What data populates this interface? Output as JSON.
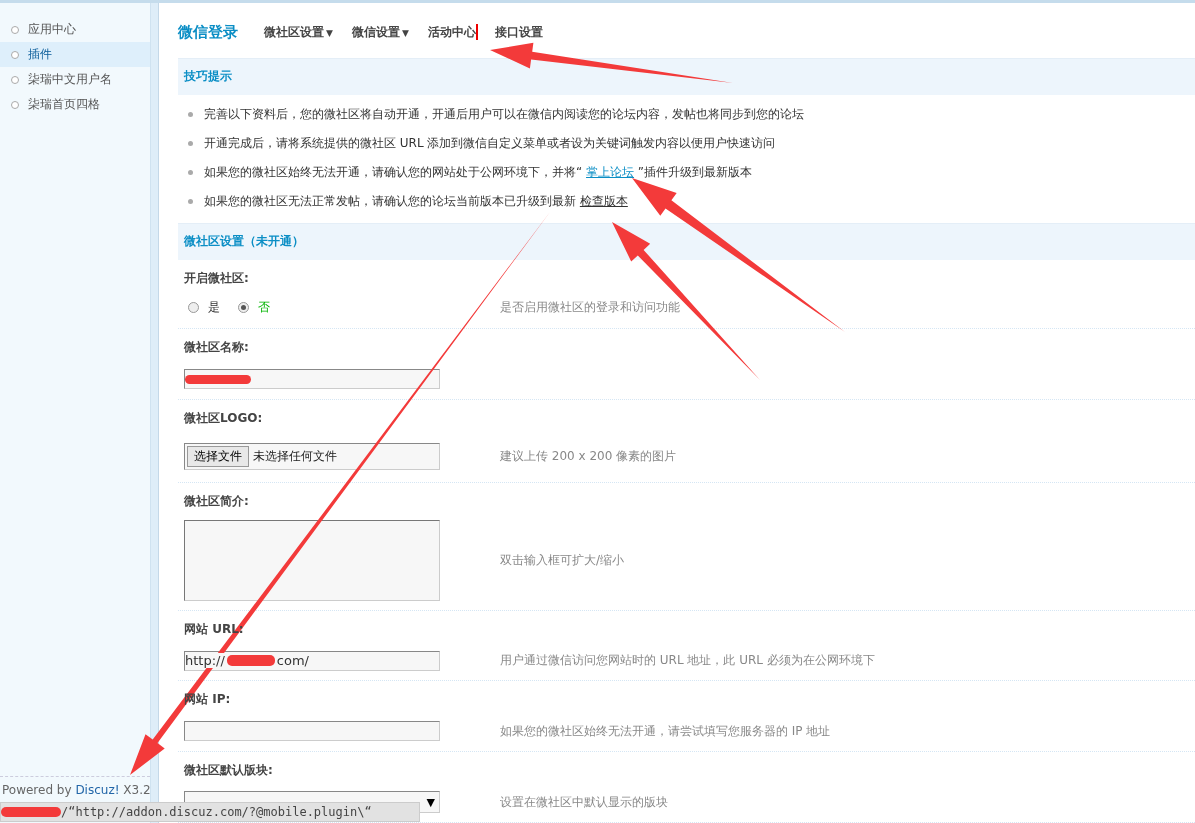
{
  "sidebar": {
    "items": [
      {
        "label": "应用中心",
        "selected": false
      },
      {
        "label": "插件",
        "selected": true
      },
      {
        "label": "柒瑞中文用户名",
        "selected": false
      },
      {
        "label": "柒瑞首页四格",
        "selected": false
      }
    ],
    "footer": {
      "prefix": "Powered by ",
      "link": "Discuz!",
      "suffix": " X3.2"
    }
  },
  "header": {
    "title": "微信登录",
    "tabs": [
      {
        "label": "微社区设置",
        "arrow": "▼"
      },
      {
        "label": "微信设置",
        "arrow": "▼"
      },
      {
        "label": "活动中心",
        "cursor": true
      },
      {
        "label": "接口设置"
      }
    ]
  },
  "tips": {
    "title": "技巧提示",
    "items": [
      {
        "text": "完善以下资料后，您的微社区将自动开通，开通后用户可以在微信内阅读您的论坛内容，发帖也将同步到您的论坛"
      },
      {
        "text": "开通完成后，请将系统提供的微社区 URL 添加到微信自定义菜单或者设为关键词触发内容以便用户快速访问"
      },
      {
        "text": "如果您的微社区始终无法开通，请确认您的网站处于公网环境下，并将“ ",
        "link": "掌上论坛",
        "color": "#0b8ec5",
        "after": " ”插件升级到最新版本"
      },
      {
        "text": "如果您的微社区无法正常发帖，请确认您的论坛当前版本已升级到最新 ",
        "link": "检查版本",
        "color": "#333333"
      }
    ]
  },
  "settings": {
    "title": "微社区设置（未开通）",
    "rows": [
      {
        "kind": "radio",
        "label": "开启微社区:",
        "options": [
          {
            "label": "是",
            "selected": false
          },
          {
            "label": "否",
            "selected": true
          }
        ],
        "help": "是否启用微社区的登录和访问功能"
      },
      {
        "kind": "text",
        "label": "微社区名称:",
        "redacted": true
      },
      {
        "kind": "file",
        "label": "微社区LOGO:",
        "button": "选择文件",
        "status": "未选择任何文件",
        "help": "建议上传 200 x 200 像素的图片"
      },
      {
        "kind": "textarea",
        "label": "微社区简介:",
        "help": "双击输入框可扩大/缩小"
      },
      {
        "kind": "text",
        "label": "网站 URL:",
        "value": "http://",
        "value_end": "com/",
        "redacted": true,
        "help": "用户通过微信访问您网站时的 URL 地址，此 URL 必须为在公网环境下"
      },
      {
        "kind": "text",
        "label": "网站 IP:",
        "help": "如果您的微社区始终无法开通，请尝试填写您服务器的 IP 地址"
      },
      {
        "kind": "select",
        "label": "微社区默认版块:",
        "arrow": "▼",
        "help": "设置在微社区中默认显示的版块"
      }
    ]
  },
  "status_bar": {
    "text": "/“http://addon.discuz.com/?@mobile.plugin\\“",
    "redacted": true
  }
}
